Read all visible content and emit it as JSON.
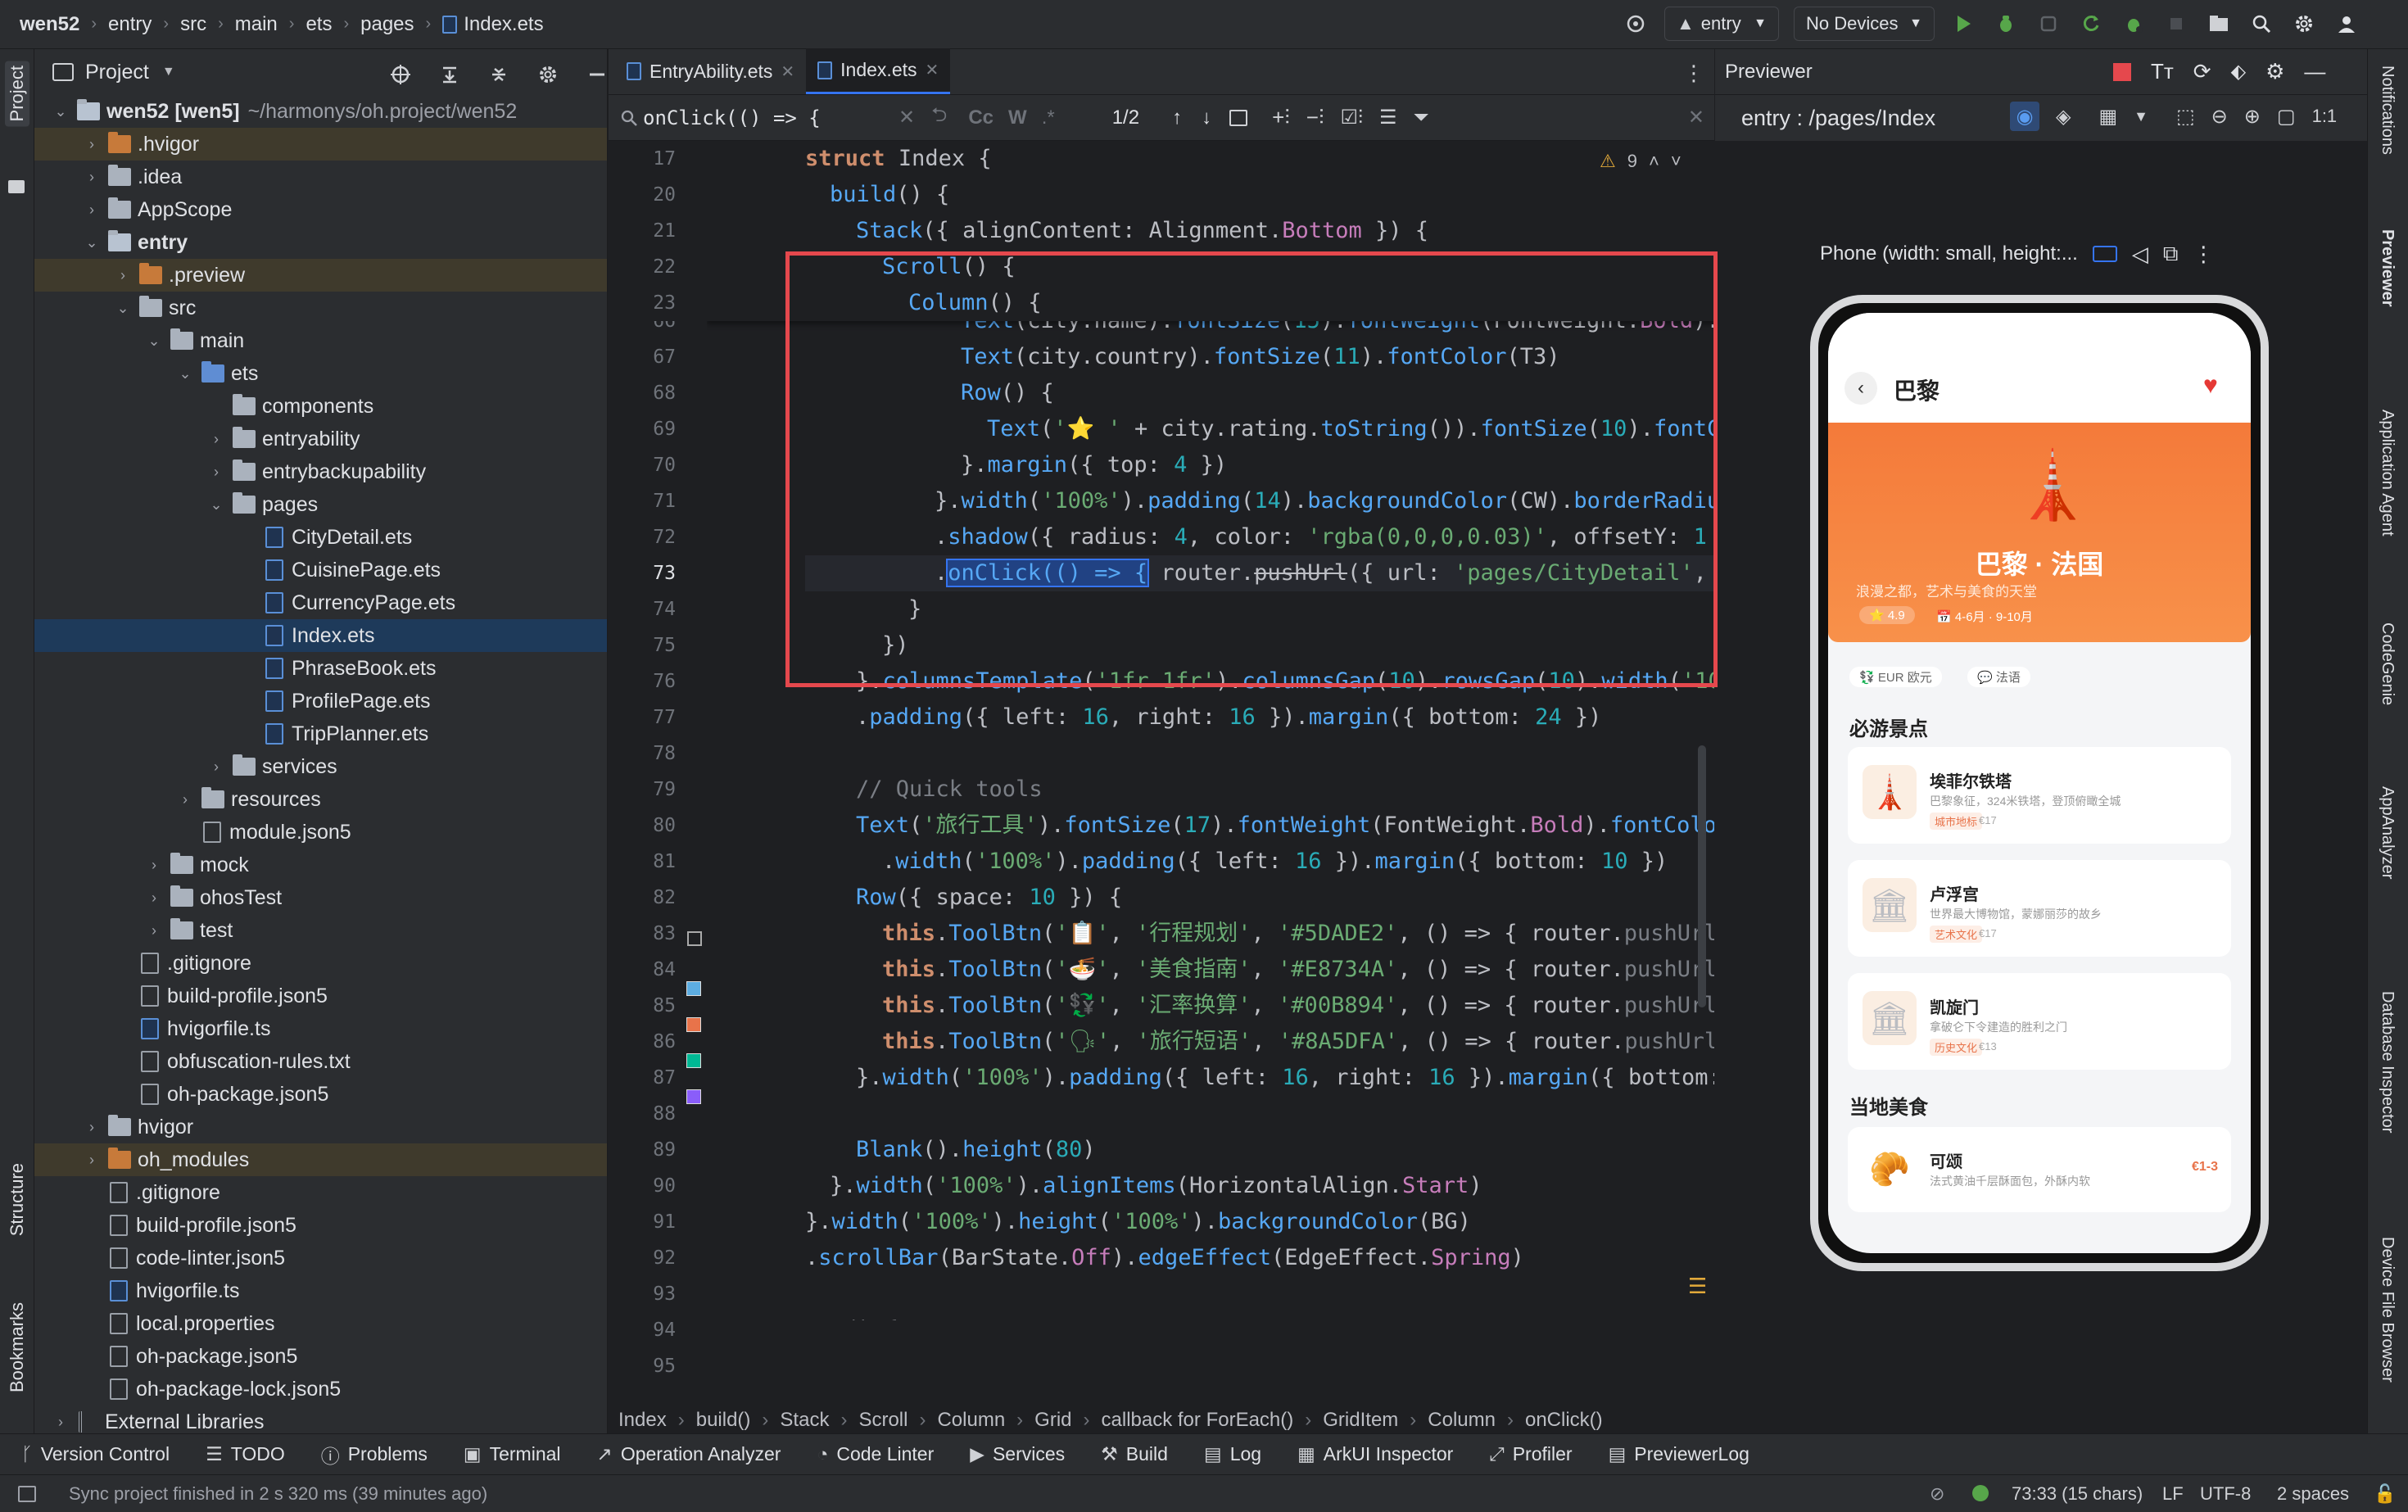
{
  "titlebar": {
    "crumbs": [
      "wen52",
      "entry",
      "src",
      "main",
      "ets",
      "pages",
      "Index.ets"
    ],
    "module": "entry",
    "device": "No Devices"
  },
  "leftstrip": {
    "project": "Project",
    "structure": "Structure",
    "bookmarks": "Bookmarks"
  },
  "project": {
    "title": "Project",
    "tree": [
      {
        "depth": 0,
        "arrow": "v",
        "icon": "module",
        "label": "wen52 [wen5]",
        "extra": "~/harmonys/oh.project/wen52",
        "bold": true
      },
      {
        "depth": 1,
        "arrow": ">",
        "icon": "folder-orange",
        "label": ".hvigor",
        "hl": true
      },
      {
        "depth": 1,
        "arrow": ">",
        "icon": "folder",
        "label": ".idea"
      },
      {
        "depth": 1,
        "arrow": ">",
        "icon": "folder",
        "label": "AppScope"
      },
      {
        "depth": 1,
        "arrow": "v",
        "icon": "module",
        "label": "entry",
        "bold": true
      },
      {
        "depth": 2,
        "arrow": ">",
        "icon": "folder-orange",
        "label": ".preview",
        "hl": true
      },
      {
        "depth": 2,
        "arrow": "v",
        "icon": "folder",
        "label": "src"
      },
      {
        "depth": 3,
        "arrow": "v",
        "icon": "folder",
        "label": "main"
      },
      {
        "depth": 4,
        "arrow": "v",
        "icon": "folder-blue",
        "label": "ets"
      },
      {
        "depth": 5,
        "arrow": "",
        "icon": "folder",
        "label": "components"
      },
      {
        "depth": 5,
        "arrow": ">",
        "icon": "folder",
        "label": "entryability"
      },
      {
        "depth": 5,
        "arrow": ">",
        "icon": "folder",
        "label": "entrybackupability"
      },
      {
        "depth": 5,
        "arrow": "v",
        "icon": "folder",
        "label": "pages"
      },
      {
        "depth": 6,
        "arrow": "",
        "icon": "ets",
        "label": "CityDetail.ets"
      },
      {
        "depth": 6,
        "arrow": "",
        "icon": "ets",
        "label": "CuisinePage.ets"
      },
      {
        "depth": 6,
        "arrow": "",
        "icon": "ets",
        "label": "CurrencyPage.ets"
      },
      {
        "depth": 6,
        "arrow": "",
        "icon": "ets",
        "label": "Index.ets",
        "sel": true
      },
      {
        "depth": 6,
        "arrow": "",
        "icon": "ets",
        "label": "PhraseBook.ets"
      },
      {
        "depth": 6,
        "arrow": "",
        "icon": "ets",
        "label": "ProfilePage.ets"
      },
      {
        "depth": 6,
        "arrow": "",
        "icon": "ets",
        "label": "TripPlanner.ets"
      },
      {
        "depth": 5,
        "arrow": ">",
        "icon": "folder",
        "label": "services"
      },
      {
        "depth": 4,
        "arrow": ">",
        "icon": "folder",
        "label": "resources"
      },
      {
        "depth": 4,
        "arrow": "",
        "icon": "file",
        "label": "module.json5"
      },
      {
        "depth": 3,
        "arrow": ">",
        "icon": "folder",
        "label": "mock"
      },
      {
        "depth": 3,
        "arrow": ">",
        "icon": "folder",
        "label": "ohosTest"
      },
      {
        "depth": 3,
        "arrow": ">",
        "icon": "folder",
        "label": "test"
      },
      {
        "depth": 2,
        "arrow": "",
        "icon": "file",
        "label": ".gitignore"
      },
      {
        "depth": 2,
        "arrow": "",
        "icon": "file",
        "label": "build-profile.json5"
      },
      {
        "depth": 2,
        "arrow": "",
        "icon": "ets",
        "label": "hvigorfile.ts"
      },
      {
        "depth": 2,
        "arrow": "",
        "icon": "file",
        "label": "obfuscation-rules.txt"
      },
      {
        "depth": 2,
        "arrow": "",
        "icon": "file",
        "label": "oh-package.json5"
      },
      {
        "depth": 1,
        "arrow": ">",
        "icon": "folder",
        "label": "hvigor"
      },
      {
        "depth": 1,
        "arrow": ">",
        "icon": "folder-orange",
        "label": "oh_modules",
        "hl": true
      },
      {
        "depth": 1,
        "arrow": "",
        "icon": "file",
        "label": ".gitignore"
      },
      {
        "depth": 1,
        "arrow": "",
        "icon": "file",
        "label": "build-profile.json5"
      },
      {
        "depth": 1,
        "arrow": "",
        "icon": "file",
        "label": "code-linter.json5"
      },
      {
        "depth": 1,
        "arrow": "",
        "icon": "ets",
        "label": "hvigorfile.ts"
      },
      {
        "depth": 1,
        "arrow": "",
        "icon": "file",
        "label": "local.properties"
      },
      {
        "depth": 1,
        "arrow": "",
        "icon": "file",
        "label": "oh-package.json5"
      },
      {
        "depth": 1,
        "arrow": "",
        "icon": "file",
        "label": "oh-package-lock.json5"
      },
      {
        "depth": 0,
        "arrow": ">",
        "icon": "lib",
        "label": "External Libraries"
      }
    ]
  },
  "editor": {
    "tabs": [
      {
        "label": "EntryAbility.ets"
      },
      {
        "label": "Index.ets",
        "active": true
      }
    ],
    "find": {
      "query": "onClick(() => {",
      "count": "1/2",
      "cc": "Cc",
      "w": "W"
    },
    "warnings": "9",
    "lines": [
      "17",
      "20",
      "21",
      "22",
      "23",
      "66",
      "67",
      "68",
      "69",
      "70",
      "71",
      "72",
      "73",
      "74",
      "75",
      "76",
      "77",
      "78",
      "79",
      "80",
      "81",
      "82",
      "83",
      "84",
      "85",
      "86",
      "87",
      "88",
      "89",
      "90",
      "91",
      "92",
      "93",
      "94",
      "95"
    ],
    "breadcrumb": [
      "Index",
      "build()",
      "Stack",
      "Scroll",
      "Column",
      "Grid",
      "callback for ForEach()",
      "GridItem",
      "Column",
      "onClick()"
    ]
  },
  "previewer": {
    "title": "Previewer",
    "route": "entry : /pages/Index",
    "device_label": "Phone (width: small, height:...",
    "app": {
      "header_title": "巴黎",
      "hero_title": "巴黎 · 法国",
      "hero_sub": "浪漫之都，艺术与美食的天堂",
      "rating": "4.9",
      "season": "4-6月 · 9-10月",
      "chip_currency": "EUR 欧元",
      "chip_lang": "法语",
      "section_sights": "必游景点",
      "sights": [
        {
          "name": "埃菲尔铁塔",
          "desc": "巴黎象征，324米铁塔，登顶俯瞰全城",
          "tag": "城市地标",
          "price": "€17",
          "icon": "🗼"
        },
        {
          "name": "卢浮宫",
          "desc": "世界最大博物馆，蒙娜丽莎的故乡",
          "tag": "艺术文化",
          "price": "€17",
          "icon": "🏛"
        },
        {
          "name": "凯旋门",
          "desc": "拿破仑下令建造的胜利之门",
          "tag": "历史文化",
          "price": "€13",
          "icon": "🏛"
        }
      ],
      "section_food": "当地美食",
      "food": {
        "name": "可颂",
        "desc": "法式黄油千层酥面包，外酥内软",
        "price": "€1-3",
        "icon": "🥐"
      }
    }
  },
  "rightstrip": [
    "Notifications",
    "Previewer",
    "Application Agent",
    "CodeGenie",
    "AppAnalyzer",
    "Database Inspector",
    "Device File Browser"
  ],
  "toolwindows": [
    "Version Control",
    "TODO",
    "Problems",
    "Terminal",
    "Operation Analyzer",
    "Code Linter",
    "Services",
    "Build",
    "Log",
    "ArkUI Inspector",
    "Profiler",
    "PreviewerLog"
  ],
  "status": {
    "message": "Sync project finished in 2 s 320 ms (39 minutes ago)",
    "position": "73:33 (15 chars)",
    "line_ending": "LF",
    "encoding": "UTF-8",
    "indent": "2 spaces"
  },
  "colors": {
    "accent": "#3574f0",
    "highlight_box": "#e5484d",
    "hero_orange": "#f47a3a",
    "heart": "#e53935"
  }
}
